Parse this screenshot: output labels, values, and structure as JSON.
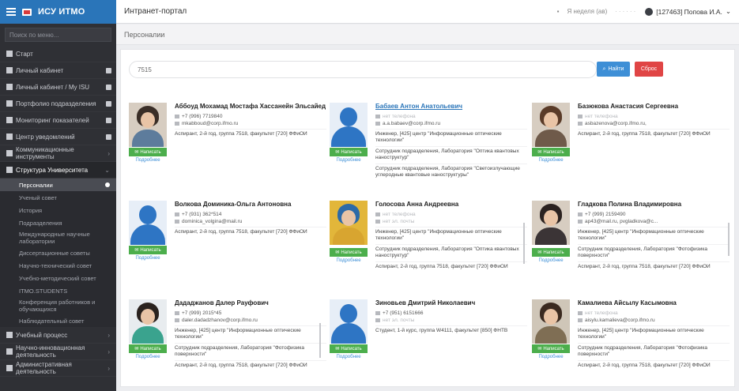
{
  "sidebar": {
    "logo": "ИСУ ИТМО",
    "search_placeholder": "Поиск по меню...",
    "items": [
      {
        "label": "Старт"
      },
      {
        "label": "Личный кабинет"
      },
      {
        "label": "Личный кабинет / My ISU"
      },
      {
        "label": "Портфолио подразделения"
      },
      {
        "label": "Мониторинг показателей"
      },
      {
        "label": "Центр уведомлений"
      },
      {
        "label": "Коммуникационные инструменты"
      },
      {
        "label": "Структура Университета"
      }
    ],
    "sub_items": [
      {
        "label": "Персоналии"
      },
      {
        "label": "Ученый совет"
      },
      {
        "label": "История"
      },
      {
        "label": "Подразделения"
      },
      {
        "label": "Международные научные лаборатории"
      },
      {
        "label": "Диссертационные советы"
      },
      {
        "label": "Научно-технический совет"
      },
      {
        "label": "Учебно-методический совет"
      },
      {
        "label": "ITMO.STUDENTS"
      },
      {
        "label": "Конференция работников и обучающихся"
      },
      {
        "label": "Наблюдательный совет"
      }
    ],
    "bottom_items": [
      {
        "label": "Учебный процесс"
      },
      {
        "label": "Научно-инновационная деятельность"
      },
      {
        "label": "Административная деятельность"
      }
    ]
  },
  "topbar": {
    "portal": "Интранет-портал",
    "lang": "Я неделя (ав)",
    "user": "[127463] Попова И.А."
  },
  "breadcrumb": "Персоналии",
  "search": {
    "value": "7515",
    "search_label": "Найти",
    "reset_label": "Сброс"
  },
  "people": [
    {
      "name": "Аббоуд Мохамад Мостафа Хассанейн Эльсайед",
      "phone": "+7 (996) 7719840",
      "email": "mkabboud@corp.ifmo.ru",
      "lines": [
        "Аспирант, 2-й год, группа 7518, факультет [720] ФФиОИ"
      ],
      "button": "Написать",
      "profile": "Подробнее"
    },
    {
      "name": "Бабаев Антон Анатольевич",
      "phone": "нет телефона",
      "email": "a.a.babaev@corp.ifmo.ru",
      "lines": [
        "Инженер, [425] центр \"Информационные оптические технологии\"",
        "Сотрудник подразделения, Лаборатория \"Оптика квантовых наноструктур\"",
        "Сотрудник подразделения, Лаборатория \"Светоизлучающие углеродные квантовые наноструктуры\""
      ],
      "button": "Написать",
      "profile": "Подробнее"
    },
    {
      "name": "Базюкова Анастасия Сергеевна",
      "phone": "нет телефона",
      "email": "asbazenova@corp.ifmo.ru,",
      "lines": [
        "Аспирант, 2-й год, группа 7518, факультет [720] ФФиОИ"
      ],
      "button": "Написать",
      "profile": "Подробнее"
    },
    {
      "name": "Волкова Доминика-Ольга Антоновна",
      "phone": "+7 (931) 362*514",
      "email": "dominica_volgina@mail.ru",
      "lines": [
        "Аспирант, 2-й год, группа 7518, факультет [720] ФФиОИ"
      ],
      "button": "Написать",
      "profile": "Подробнее"
    },
    {
      "name": "Голосова Анна Андреевна",
      "phone": "нет телефона",
      "email": "нет эл. почты",
      "lines": [
        "Инженер, [425] центр \"Информационные оптические технологии\"",
        "Сотрудник подразделения, Лаборатория \"Оптика квантовых наноструктур\"",
        "Аспирант, 2-й год, группа 7518, факультет [720] ФФиОИ"
      ],
      "button": "Написать",
      "profile": "Подробнее"
    },
    {
      "name": "Гладкова Полина Владимировна",
      "phone": "+7 (999) 2159490",
      "email": "ap43@mail.ru, pvgladkova@c...",
      "lines": [
        "Инженер, [425] центр \"Информационные оптические технологии\"",
        "Сотрудник подразделения, Лаборатория \"Фотофизика поверхности\"",
        "Аспирант, 2-й год, группа 7518, факультет [720] ФФиОИ"
      ],
      "button": "Написать",
      "profile": "Подробнее"
    },
    {
      "name": "Дададжанов Далер Рауфович",
      "phone": "+7 (999) 2015*45",
      "email": "daler.dadadzhanov@corp.ifmo.ru",
      "lines": [
        "Инженер, [425] центр \"Информационные оптические технологии\"",
        "Сотрудник подразделения, Лаборатория \"Фотофизика поверхности\"",
        "Аспирант, 2-й год, группа 7518, факультет [720] ФФиОИ"
      ],
      "button": "Написать",
      "profile": "Подробнее"
    },
    {
      "name": "Зиновьев Дмитрий Николаевич",
      "phone": "+7 (951) 6151666",
      "email": "нет эл. почты",
      "lines": [
        "Студент, 1-й курс, группа W4111, факультет [850] ФНТВ"
      ],
      "button": "Написать",
      "profile": "Подробнее"
    },
    {
      "name": "Камалиева Айсылу Касымовна",
      "phone": "нет телефона",
      "email": "aisylu.kamalieva@corp.ifmo.ru",
      "lines": [
        "Инженер, [425] центр \"Информационные оптические технологии\"",
        "Сотрудник подразделения, Лаборатория \"Фотофизика поверхности\"",
        "Аспирант, 2-й год, группа 7518, факультет [720] ФФиОИ"
      ],
      "button": "Написать",
      "profile": "Подробнее"
    }
  ]
}
